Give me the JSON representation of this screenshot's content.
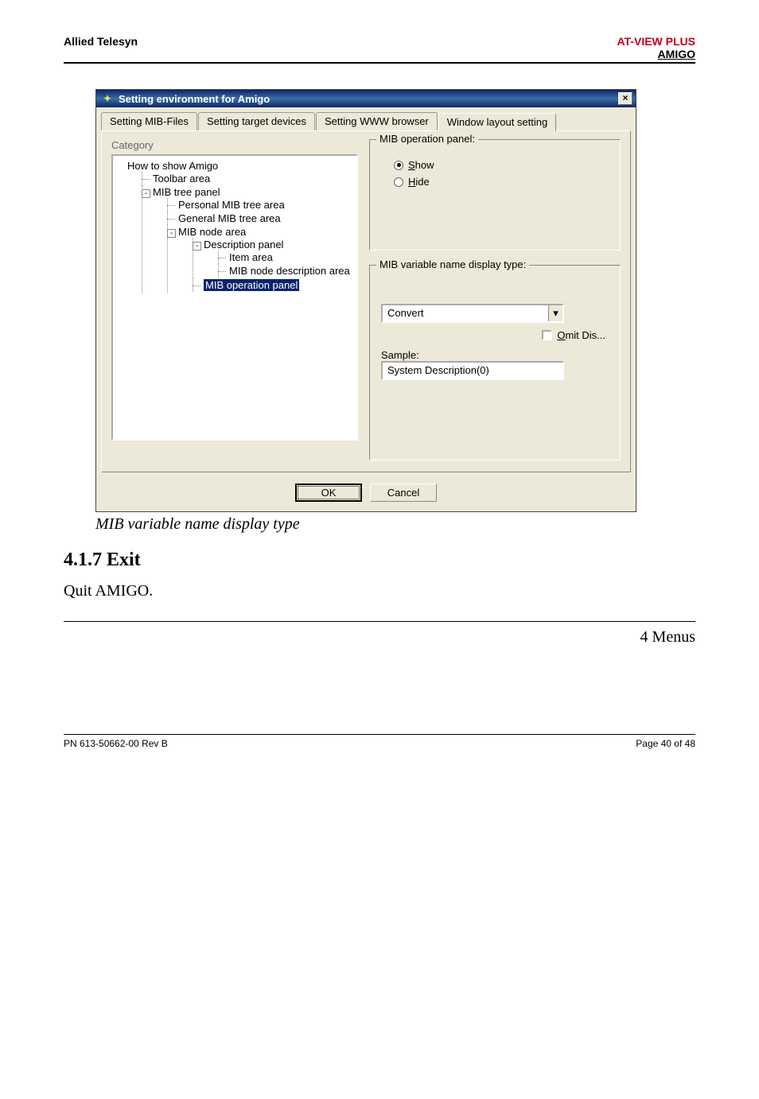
{
  "header": {
    "left": "Allied Telesyn",
    "right1": "AT-VIEW PLUS",
    "right2": "AMIGO"
  },
  "dialog": {
    "title": "Setting environment for Amigo",
    "close": "×",
    "tabs": [
      "Setting MIB-Files",
      "Setting target devices",
      "Setting WWW browser",
      "Window layout setting"
    ],
    "activeTab": 3,
    "categoryLabel": "Category",
    "tree": {
      "root": "How to show Amigo",
      "toolbar": "Toolbar area",
      "mibTree": "MIB tree panel",
      "personal": "Personal MIB tree area",
      "general": "General MIB tree area",
      "nodeArea": "MIB node area",
      "descPanel": "Description panel",
      "itemArea": "Item area",
      "nodeDesc": "MIB node description area",
      "opPanel": "MIB operation panel"
    },
    "group1": {
      "legend": "MIB operation panel:",
      "show": "Show",
      "hide": "Hide"
    },
    "group2": {
      "legend": "MIB variable name display type:",
      "comboValue": "Convert",
      "omit": "Omit Dis...",
      "sampleLabel": "Sample:",
      "sampleValue": "System Description(0)"
    },
    "ok": "OK",
    "cancel": "Cancel"
  },
  "caption": "MIB variable name display type",
  "section": {
    "heading": "4.1.7 Exit",
    "body": "Quit AMIGO."
  },
  "menus": "4 Menus",
  "footer": {
    "left": "PN 613-50662-00 Rev B",
    "right": "Page 40 of 48"
  }
}
